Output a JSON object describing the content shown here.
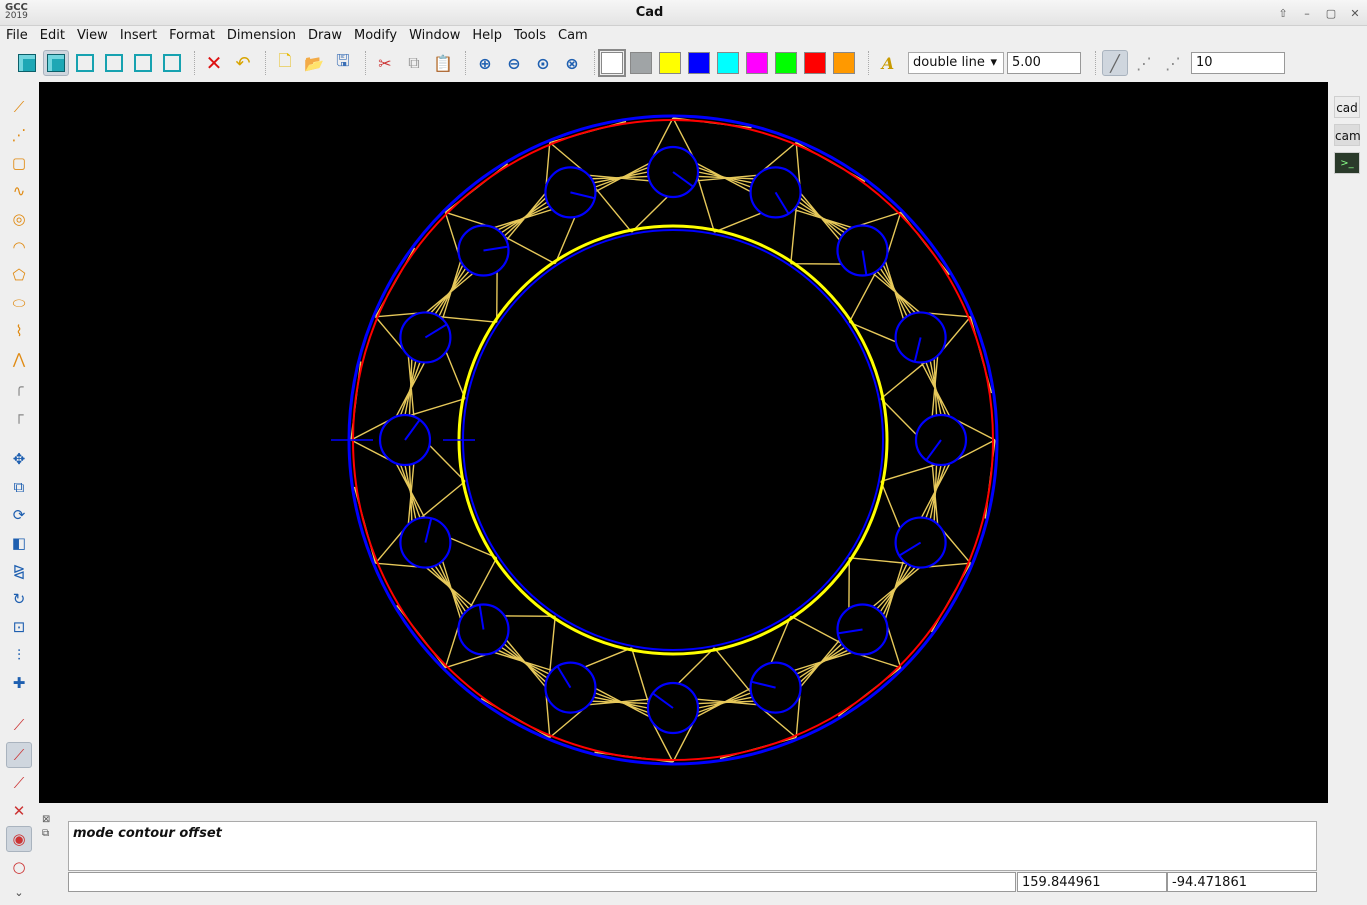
{
  "app": {
    "logo_top": "GCC",
    "logo_bottom": "2019",
    "title": "Cad"
  },
  "window_controls": [
    "up-arrow-icon",
    "minimize-icon",
    "maximize-icon",
    "close-icon"
  ],
  "menu": [
    "File",
    "Edit",
    "View",
    "Insert",
    "Format",
    "Dimension",
    "Draw",
    "Modify",
    "Window",
    "Help",
    "Tools",
    "Cam"
  ],
  "toolbar": {
    "view_buttons": [
      "view-iso-solid-icon",
      "view-iso-wire-icon",
      "view-front-icon",
      "view-side-icon",
      "view-top-icon",
      "view-bottom-icon"
    ],
    "colors": [
      "#ffffff",
      "#a0a4a6",
      "#ffff00",
      "#0000ff",
      "#00ffff",
      "#ff00ff",
      "#00ff00",
      "#ff0000",
      "#ff9900"
    ],
    "line_type": "double line",
    "line_width": "5.00",
    "count": "10"
  },
  "left_tools": [
    "line-icon",
    "polyline-icon",
    "rectangle-icon",
    "spline-icon",
    "circle-icon",
    "arc-icon",
    "polygon-icon",
    "ellipse-icon",
    "bezier-icon",
    "nurbs-icon",
    "fillet-icon",
    "chamfer-icon",
    "move-icon",
    "copy-icon",
    "offset-icon",
    "stretch-icon",
    "mirror-icon",
    "rotate-icon",
    "scale-icon",
    "trim-icon",
    "extend-icon",
    "snap-end-icon",
    "snap-mid-icon",
    "snap-near-icon",
    "snap-intersection-icon",
    "snap-center-icon",
    "snap-circle-icon",
    "more-chevron-icon"
  ],
  "right_tabs": {
    "cad": "cad",
    "cam": "cam",
    "terminal": "terminal-icon"
  },
  "drawing": {
    "outer_circle_color": "#0000ff",
    "red_circle_color": "#ff0000",
    "pattern_color": "#e6c85a",
    "inner_yellow_color": "#ffff00",
    "hole_count": 16
  },
  "console": {
    "log": "mode contour offset",
    "command": "",
    "coord_x": "159.844961",
    "coord_y": "-94.471861"
  }
}
